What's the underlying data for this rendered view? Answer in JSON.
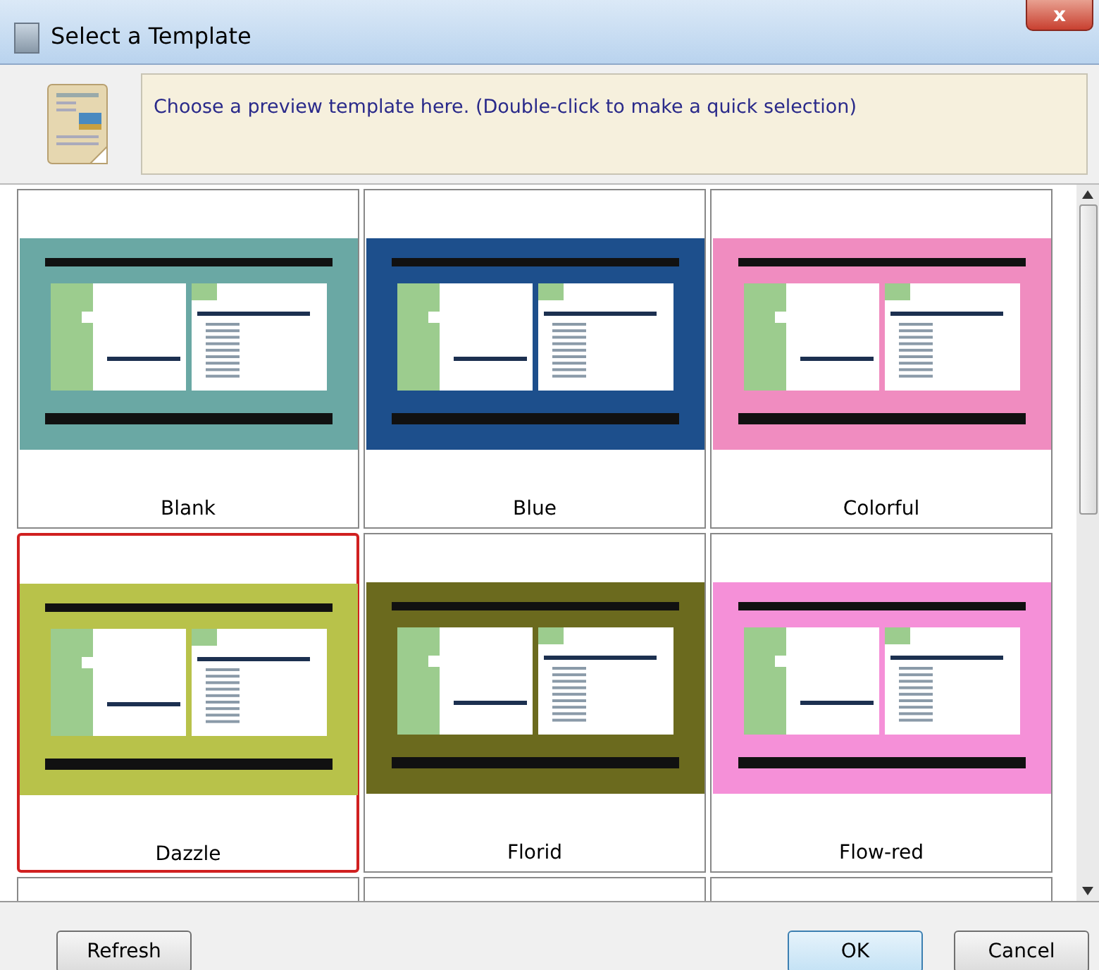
{
  "window": {
    "title": "Select a Template",
    "close": "x"
  },
  "header": {
    "message": "Choose a preview template here. (Double-click to make a quick selection)"
  },
  "templates": [
    {
      "label": "Blank",
      "color": "#6aa8a4",
      "selected": false
    },
    {
      "label": "Blue",
      "color": "#1d4f8c",
      "selected": false
    },
    {
      "label": "Colorful",
      "color": "#f08cc0",
      "selected": false
    },
    {
      "label": "Dazzle",
      "color": "#b8c24a",
      "selected": true
    },
    {
      "label": "Florid",
      "color": "#6b6a1e",
      "selected": false
    },
    {
      "label": "Flow-red",
      "color": "#f590d8",
      "selected": false
    }
  ],
  "buttons": [
    {
      "label": "Refresh",
      "kind": "left"
    },
    {
      "label": "OK",
      "kind": "default"
    },
    {
      "label": "Cancel",
      "kind": "normal"
    }
  ]
}
